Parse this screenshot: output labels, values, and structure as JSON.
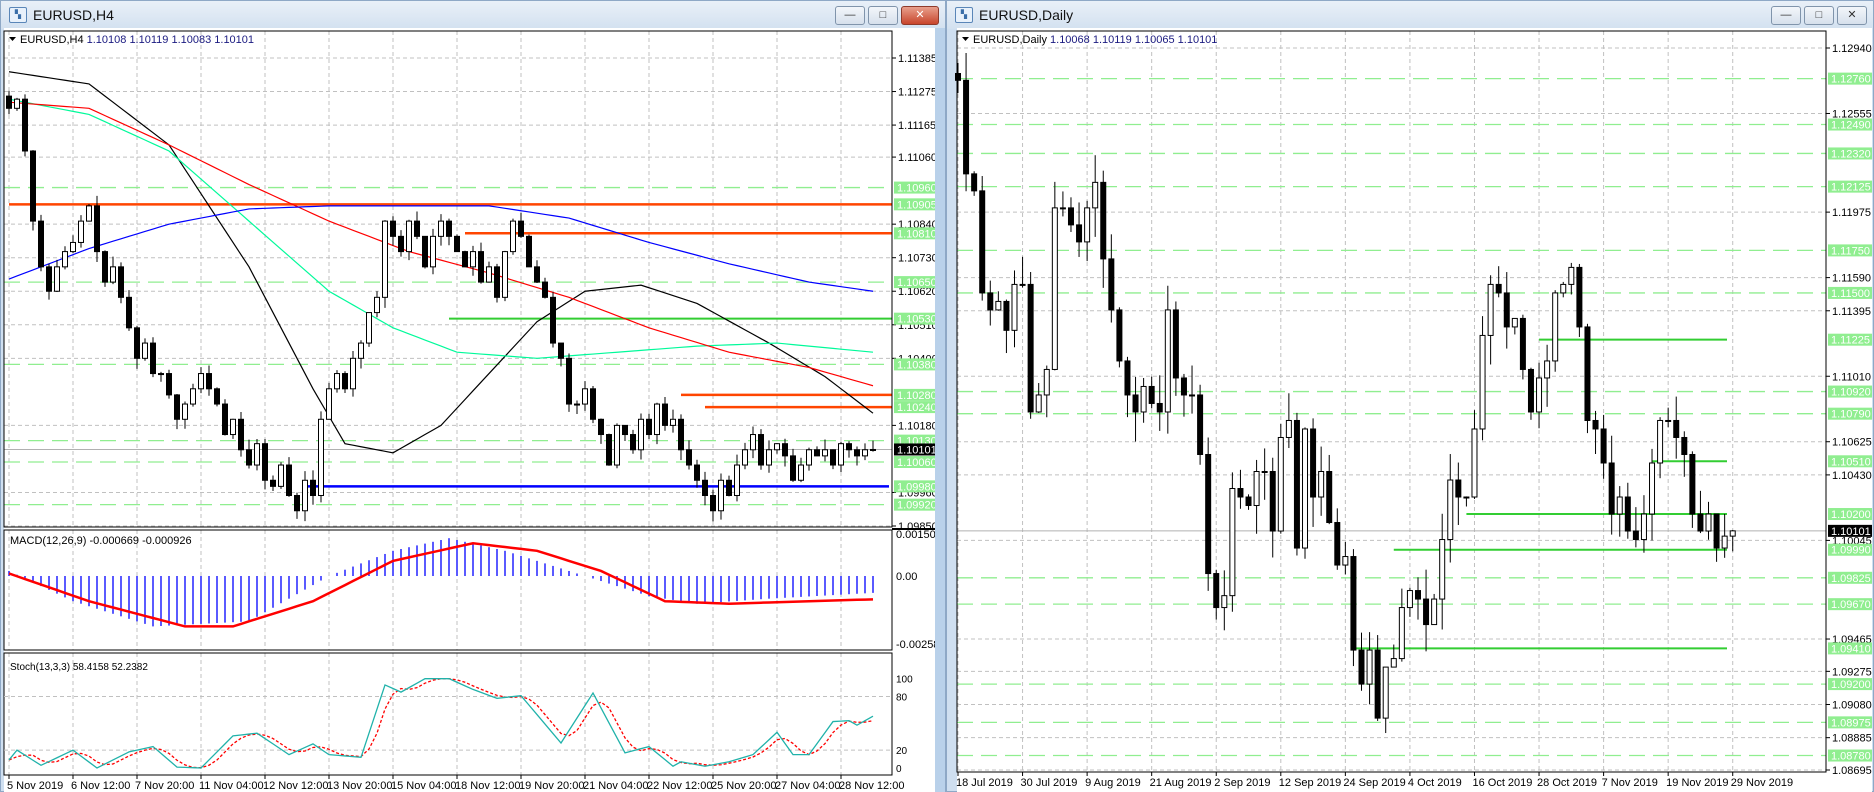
{
  "colors": {
    "bull": "#ffffff",
    "bear": "#000000",
    "grid": "#c0c0c0",
    "level_dashed": "#90ee90",
    "level_label_bg": "#90ee90",
    "resistance": "#ff4500",
    "support_blue": "#0000ff",
    "support_green": "#32cd32",
    "ma_black": "#000000",
    "ma_green": "#00fa9a",
    "ma_red": "#ff0000",
    "ma_blue": "#0000ff",
    "macd_hist": "#0000ff",
    "macd_signal": "#ff0000",
    "stoch_main": "#20b2aa",
    "stoch_signal": "#ff0000"
  },
  "windows": {
    "h4": {
      "title": "EURUSD,H4",
      "header": "EURUSD,H4",
      "ohlc": "1.10108 1.10119 1.10083 1.10101",
      "buttons": {
        "minimize": "—",
        "maximize": "□",
        "close": "✕"
      },
      "current_price": "1.10101",
      "price_axis": [
        "1.11385",
        "1.11275",
        "1.11165",
        "1.11060",
        "1.10840",
        "1.10730",
        "1.10620",
        "1.10510",
        "1.10400",
        "1.10180",
        "1.09960",
        "1.09850"
      ],
      "level_labels": [
        "1.10960",
        "1.10905",
        "1.10810",
        "1.10650",
        "1.10530",
        "1.10380",
        "1.10280",
        "1.10240",
        "1.10130",
        "1.10060",
        "1.09980",
        "1.09920"
      ],
      "dashed_levels": [
        "1.10960",
        "1.10650",
        "1.10380",
        "1.10130",
        "1.10060",
        "1.09920"
      ],
      "lines": [
        {
          "price": "1.10905",
          "color": "resistance",
          "from_bar": 0
        },
        {
          "price": "1.10810",
          "color": "resistance",
          "from_bar": 57
        },
        {
          "price": "1.10530",
          "color": "support_green",
          "from_bar": 55
        },
        {
          "price": "1.10280",
          "color": "resistance",
          "from_bar": 84
        },
        {
          "price": "1.10240",
          "color": "resistance",
          "from_bar": 87
        },
        {
          "price": "1.09980",
          "color": "support_blue",
          "from_bar": 37
        }
      ],
      "time_axis": [
        {
          "bar": 0,
          "label": "5 Nov 2019"
        },
        {
          "bar": 8,
          "label": "6 Nov 12:00"
        },
        {
          "bar": 16,
          "label": "7 Nov 20:00"
        },
        {
          "bar": 24,
          "label": "11 Nov 04:00"
        },
        {
          "bar": 32,
          "label": "12 Nov 12:00"
        },
        {
          "bar": 40,
          "label": "13 Nov 20:00"
        },
        {
          "bar": 48,
          "label": "15 Nov 04:00"
        },
        {
          "bar": 56,
          "label": "18 Nov 12:00"
        },
        {
          "bar": 64,
          "label": "19 Nov 20:00"
        },
        {
          "bar": 72,
          "label": "21 Nov 04:00"
        },
        {
          "bar": 80,
          "label": "22 Nov 12:00"
        },
        {
          "bar": 88,
          "label": "25 Nov 20:00"
        },
        {
          "bar": 96,
          "label": "27 Nov 04:00"
        },
        {
          "bar": 104,
          "label": "28 Nov 12:00"
        }
      ],
      "closes": [
        1.1122,
        1.1125,
        1.1108,
        1.1085,
        1.107,
        1.1062,
        1.107,
        1.1075,
        1.1078,
        1.1085,
        1.109,
        1.1075,
        1.1065,
        1.107,
        1.106,
        1.105,
        1.104,
        1.1045,
        1.1035,
        1.1035,
        1.1028,
        1.102,
        1.1025,
        1.103,
        1.1035,
        1.103,
        1.1025,
        1.1015,
        1.102,
        1.101,
        1.1005,
        1.1012,
        1.1,
        1.0998,
        1.1005,
        1.0995,
        1.099,
        1.1,
        1.0995,
        1.102,
        1.103,
        1.1035,
        1.103,
        1.104,
        1.1045,
        1.1055,
        1.106,
        1.1085,
        1.108,
        1.1075,
        1.1085,
        1.108,
        1.107,
        1.108,
        1.1085,
        1.108,
        1.1075,
        1.107,
        1.1075,
        1.1065,
        1.107,
        1.106,
        1.1075,
        1.1085,
        1.108,
        1.107,
        1.1065,
        1.106,
        1.1045,
        1.104,
        1.1025,
        1.1025,
        1.103,
        1.102,
        1.1015,
        1.1005,
        1.1018,
        1.1015,
        1.101,
        1.102,
        1.1015,
        1.1025,
        1.1018,
        1.102,
        1.101,
        1.1005,
        1.1,
        1.0995,
        1.099,
        1.1,
        1.0995,
        1.1005,
        1.101,
        1.1015,
        1.1005,
        1.101,
        1.1012,
        1.1008,
        1.1,
        1.1005,
        1.101,
        1.1008,
        1.101,
        1.1005,
        1.1012,
        1.101,
        1.1008,
        1.101,
        1.10101
      ],
      "moving_averages": [
        {
          "color": "ma_black",
          "points": [
            [
              0,
              1.1134
            ],
            [
              10,
              1.113
            ],
            [
              20,
              1.111
            ],
            [
              30,
              1.107
            ],
            [
              38,
              1.103
            ],
            [
              42,
              1.1012
            ],
            [
              48,
              1.1009
            ],
            [
              54,
              1.1018
            ],
            [
              60,
              1.1035
            ],
            [
              66,
              1.1052
            ],
            [
              72,
              1.1062
            ],
            [
              79,
              1.1064
            ],
            [
              86,
              1.1058
            ],
            [
              95,
              1.1045
            ],
            [
              102,
              1.1034
            ],
            [
              108,
              1.1022
            ]
          ]
        },
        {
          "color": "ma_green",
          "points": [
            [
              0,
              1.1125
            ],
            [
              10,
              1.112
            ],
            [
              20,
              1.1108
            ],
            [
              30,
              1.1085
            ],
            [
              40,
              1.1062
            ],
            [
              48,
              1.105
            ],
            [
              56,
              1.1042
            ],
            [
              66,
              1.104
            ],
            [
              76,
              1.1042
            ],
            [
              86,
              1.1044
            ],
            [
              96,
              1.1045
            ],
            [
              108,
              1.1042
            ]
          ]
        },
        {
          "color": "ma_red",
          "points": [
            [
              0,
              1.1124
            ],
            [
              10,
              1.1122
            ],
            [
              20,
              1.111
            ],
            [
              30,
              1.1097
            ],
            [
              40,
              1.1085
            ],
            [
              50,
              1.1075
            ],
            [
              60,
              1.1068
            ],
            [
              70,
              1.106
            ],
            [
              80,
              1.105
            ],
            [
              90,
              1.1042
            ],
            [
              100,
              1.1037
            ],
            [
              108,
              1.1031
            ]
          ]
        },
        {
          "color": "ma_blue",
          "points": [
            [
              0,
              1.1066
            ],
            [
              10,
              1.1076
            ],
            [
              20,
              1.1084
            ],
            [
              30,
              1.1089
            ],
            [
              40,
              1.109
            ],
            [
              50,
              1.109
            ],
            [
              60,
              1.109
            ],
            [
              70,
              1.1086
            ],
            [
              80,
              1.1078
            ],
            [
              90,
              1.1071
            ],
            [
              100,
              1.1065
            ],
            [
              108,
              1.1062
            ]
          ]
        }
      ],
      "macd": {
        "label": "MACD(12,26,9) -0.000669 -0.000926",
        "axis": [
          "0.001508",
          "0.00",
          "-0.002583"
        ],
        "range": [
          -0.002583,
          0.001508
        ],
        "hist_points": [
          [
            0,
            0.0002
          ],
          [
            8,
            -0.001
          ],
          [
            18,
            -0.002
          ],
          [
            30,
            -0.0018
          ],
          [
            40,
            0
          ],
          [
            48,
            0.001
          ],
          [
            55,
            0.0015
          ],
          [
            62,
            0.001
          ],
          [
            72,
            0
          ],
          [
            80,
            -0.0008
          ],
          [
            86,
            -0.0011
          ],
          [
            95,
            -0.0009
          ],
          [
            108,
            -0.00067
          ]
        ],
        "signal_points": [
          [
            0,
            0.0001
          ],
          [
            10,
            -0.001
          ],
          [
            22,
            -0.002
          ],
          [
            28,
            -0.002
          ],
          [
            38,
            -0.001
          ],
          [
            48,
            0.0006
          ],
          [
            58,
            0.0013
          ],
          [
            66,
            0.001
          ],
          [
            74,
            0.0002
          ],
          [
            82,
            -0.001
          ],
          [
            90,
            -0.0011
          ],
          [
            100,
            -0.001
          ],
          [
            108,
            -0.000926
          ]
        ]
      },
      "stoch": {
        "label": "Stoch(13,3,3) 58.4158 52.2382",
        "axis": [
          "100",
          "80",
          "20",
          "0"
        ],
        "main_points": [
          [
            0,
            9
          ],
          [
            1,
            20
          ],
          [
            4,
            3
          ],
          [
            8,
            20
          ],
          [
            11,
            0
          ],
          [
            15,
            18
          ],
          [
            18,
            24
          ],
          [
            21,
            1
          ],
          [
            24,
            0
          ],
          [
            28,
            36
          ],
          [
            31,
            39
          ],
          [
            35,
            15
          ],
          [
            38,
            27
          ],
          [
            40,
            15
          ],
          [
            44,
            12
          ],
          [
            47,
            93
          ],
          [
            49,
            85
          ],
          [
            52,
            100
          ],
          [
            55,
            100
          ],
          [
            58,
            88
          ],
          [
            61,
            78
          ],
          [
            64,
            81
          ],
          [
            69,
            28
          ],
          [
            73,
            84
          ],
          [
            77,
            17
          ],
          [
            80,
            24
          ],
          [
            83,
            2
          ],
          [
            84,
            7
          ],
          [
            87,
            2
          ],
          [
            90,
            7
          ],
          [
            93,
            15
          ],
          [
            96,
            40
          ],
          [
            98,
            15
          ],
          [
            100,
            15
          ],
          [
            103,
            52
          ],
          [
            105,
            53
          ],
          [
            106,
            48
          ],
          [
            108,
            58
          ]
        ]
      }
    },
    "daily": {
      "title": "EURUSD,Daily",
      "header": "EURUSD,Daily",
      "ohlc": "1.10068 1.10119 1.10065 1.10101",
      "buttons": {
        "minimize": "—",
        "maximize": "□",
        "close": "✕"
      },
      "current_price": "1.10101",
      "price_axis": [
        "1.12940",
        "1.12555",
        "1.11975",
        "1.11590",
        "1.11395",
        "1.11010",
        "1.10625",
        "1.10430",
        "1.10045",
        "1.09465",
        "1.09275",
        "1.09080",
        "1.08885",
        "1.08695"
      ],
      "level_labels": [
        "1.12760",
        "1.12490",
        "1.12320",
        "1.12125",
        "1.11750",
        "1.11500",
        "1.11225",
        "1.10920",
        "1.10790",
        "1.10510",
        "1.10200",
        "1.09990",
        "1.09825",
        "1.09670",
        "1.09410",
        "1.09200",
        "1.08975",
        "1.08780"
      ],
      "dashed_levels": [
        "1.12760",
        "1.12490",
        "1.12320",
        "1.12125",
        "1.11750",
        "1.11500",
        "1.10920",
        "1.10790",
        "1.09825",
        "1.09670",
        "1.09200",
        "1.08975",
        "1.08780"
      ],
      "lines": [
        {
          "price": "1.11225",
          "color": "support_green",
          "from_bar": 72
        },
        {
          "price": "1.10510",
          "color": "support_green",
          "from_bar": 86
        },
        {
          "price": "1.10200",
          "color": "support_green",
          "from_bar": 63
        },
        {
          "price": "1.09990",
          "color": "support_green",
          "from_bar": 54
        },
        {
          "price": "1.09410",
          "color": "support_green",
          "from_bar": 49
        }
      ],
      "time_axis": [
        {
          "bar": 0,
          "label": "18 Jul 2019"
        },
        {
          "bar": 8,
          "label": "30 Jul 2019"
        },
        {
          "bar": 16,
          "label": "9 Aug 2019"
        },
        {
          "bar": 24,
          "label": "21 Aug 2019"
        },
        {
          "bar": 32,
          "label": "2 Sep 2019"
        },
        {
          "bar": 40,
          "label": "12 Sep 2019"
        },
        {
          "bar": 48,
          "label": "24 Sep 2019"
        },
        {
          "bar": 56,
          "label": "4 Oct 2019"
        },
        {
          "bar": 64,
          "label": "16 Oct 2019"
        },
        {
          "bar": 72,
          "label": "28 Oct 2019"
        },
        {
          "bar": 80,
          "label": "7 Nov 2019"
        },
        {
          "bar": 88,
          "label": "19 Nov 2019"
        },
        {
          "bar": 96,
          "label": "29 Nov 2019"
        }
      ],
      "closes": [
        1.1275,
        1.122,
        1.121,
        1.115,
        1.114,
        1.1145,
        1.1128,
        1.1155,
        1.1155,
        1.108,
        1.109,
        1.1105,
        1.12,
        1.12,
        1.119,
        1.118,
        1.12,
        1.1215,
        1.117,
        1.114,
        1.111,
        1.109,
        1.108,
        1.1095,
        1.1085,
        1.108,
        1.114,
        1.11,
        1.109,
        1.109,
        1.1055,
        1.0985,
        1.0965,
        1.0972,
        1.1035,
        1.103,
        1.1025,
        1.1045,
        1.1045,
        1.101,
        1.1065,
        1.1075,
        1.1,
        1.107,
        1.103,
        1.1045,
        1.1015,
        1.099,
        1.0995,
        1.094,
        1.092,
        1.094,
        1.09,
        1.093,
        1.0935,
        1.0965,
        1.0975,
        1.097,
        1.0955,
        1.097,
        1.1005,
        1.104,
        1.103,
        1.103,
        1.107,
        1.1125,
        1.1155,
        1.115,
        1.113,
        1.1135,
        1.1105,
        1.108,
        1.11,
        1.111,
        1.115,
        1.1155,
        1.1165,
        1.113,
        1.1075,
        1.107,
        1.105,
        1.102,
        1.103,
        1.101,
        1.1005,
        1.102,
        1.105,
        1.1075,
        1.1075,
        1.1065,
        1.1055,
        1.102,
        1.101,
        1.102,
        1.1,
        1.1007,
        1.10101
      ]
    }
  }
}
